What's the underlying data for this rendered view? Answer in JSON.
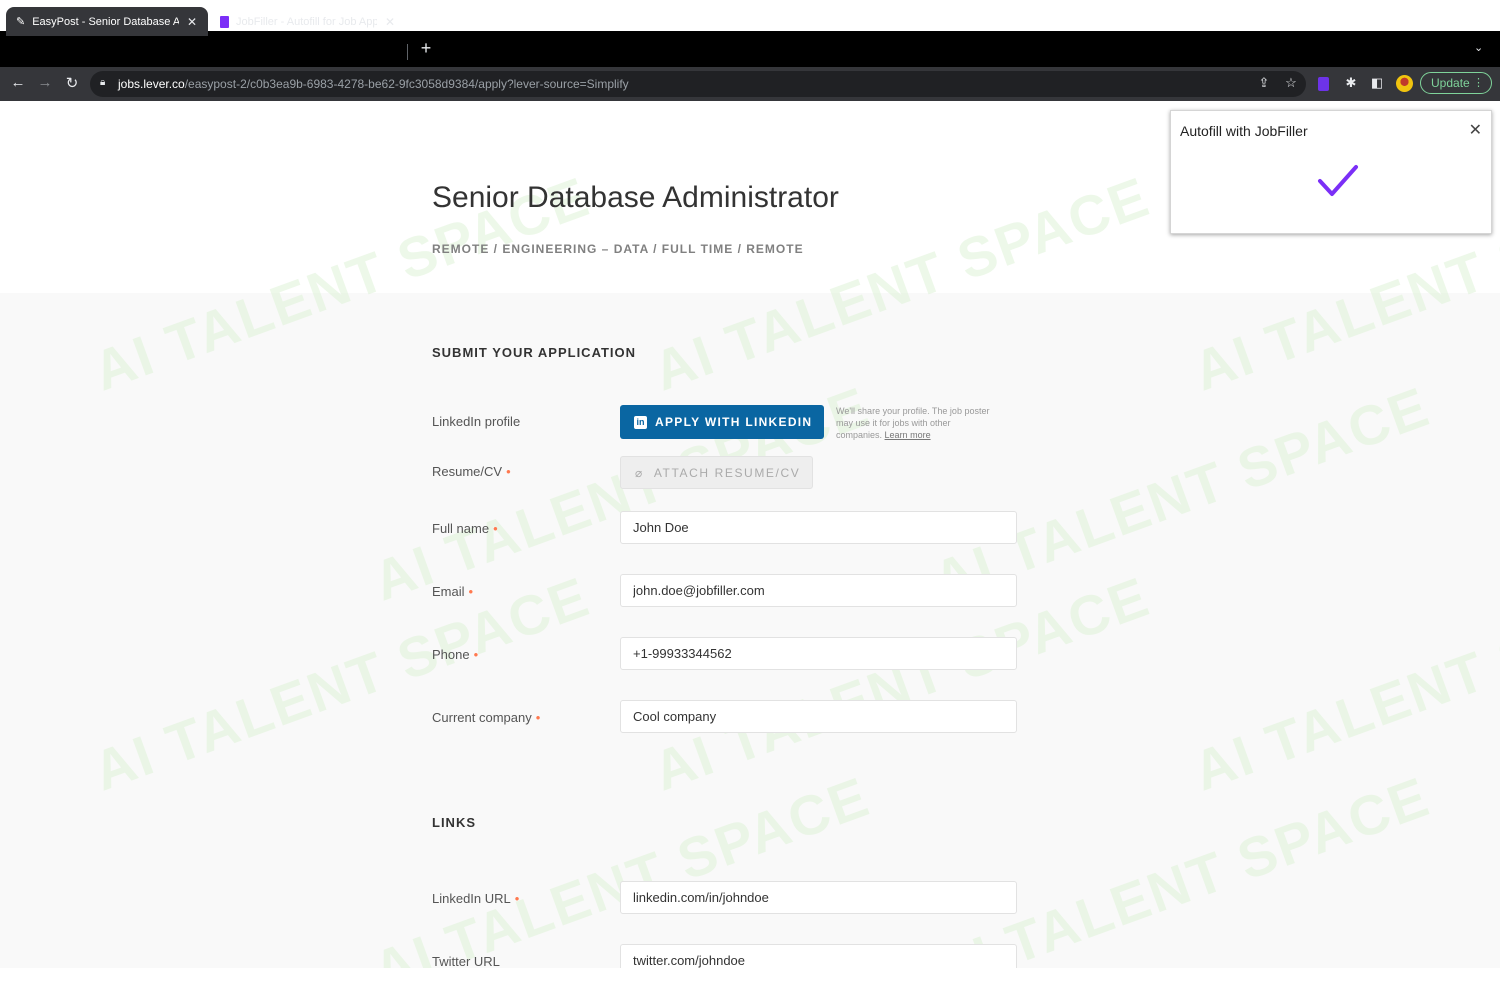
{
  "browser": {
    "tabs": [
      {
        "title": "EasyPost - Senior Database Ad",
        "active": true
      },
      {
        "title": "JobFiller - Autofill for Job Appl",
        "active": false
      }
    ],
    "new_tab_icon": "+",
    "url_host": "jobs.lever.co",
    "url_path": "/easypost-2/c0b3ea9b-6983-4278-be62-9fc3058d9384/apply?lever-source=Simplify",
    "update_label": "Update"
  },
  "popup": {
    "title": "Autofill with JobFiller",
    "close_glyph": "✕",
    "check_color": "#7b2ff7"
  },
  "job": {
    "title": "Senior Database Administrator",
    "breadcrumbs": "REMOTE /  ENGINEERING – DATA /  FULL TIME   / REMOTE"
  },
  "application": {
    "heading": "SUBMIT YOUR APPLICATION",
    "linkedin_label": "LinkedIn profile",
    "linkedin_button": "APPLY WITH LINKEDIN",
    "linkedin_note": "We'll share your profile. The job poster may use it for jobs with other companies.",
    "learn_more": "Learn more",
    "resume_label": "Resume/CV",
    "resume_button": "ATTACH RESUME/CV",
    "required_mark": "•",
    "fields": [
      {
        "label": "Full name",
        "value": "John Doe"
      },
      {
        "label": "Email",
        "value": "john.doe@jobfiller.com"
      },
      {
        "label": "Phone",
        "value": "+1-99933344562"
      },
      {
        "label": "Current company",
        "value": "Cool company"
      }
    ]
  },
  "links": {
    "heading": "LINKS",
    "fields": [
      {
        "label": "LinkedIn URL",
        "value": "linkedin.com/in/johndoe"
      },
      {
        "label": "Twitter URL",
        "value": "twitter.com/johndoe"
      }
    ]
  },
  "watermark": "AI TALENT SPACE",
  "colors": {
    "linkedin_blue": "#0a66a2",
    "required_orange": "#ff794f",
    "update_green": "#7fd39a"
  }
}
